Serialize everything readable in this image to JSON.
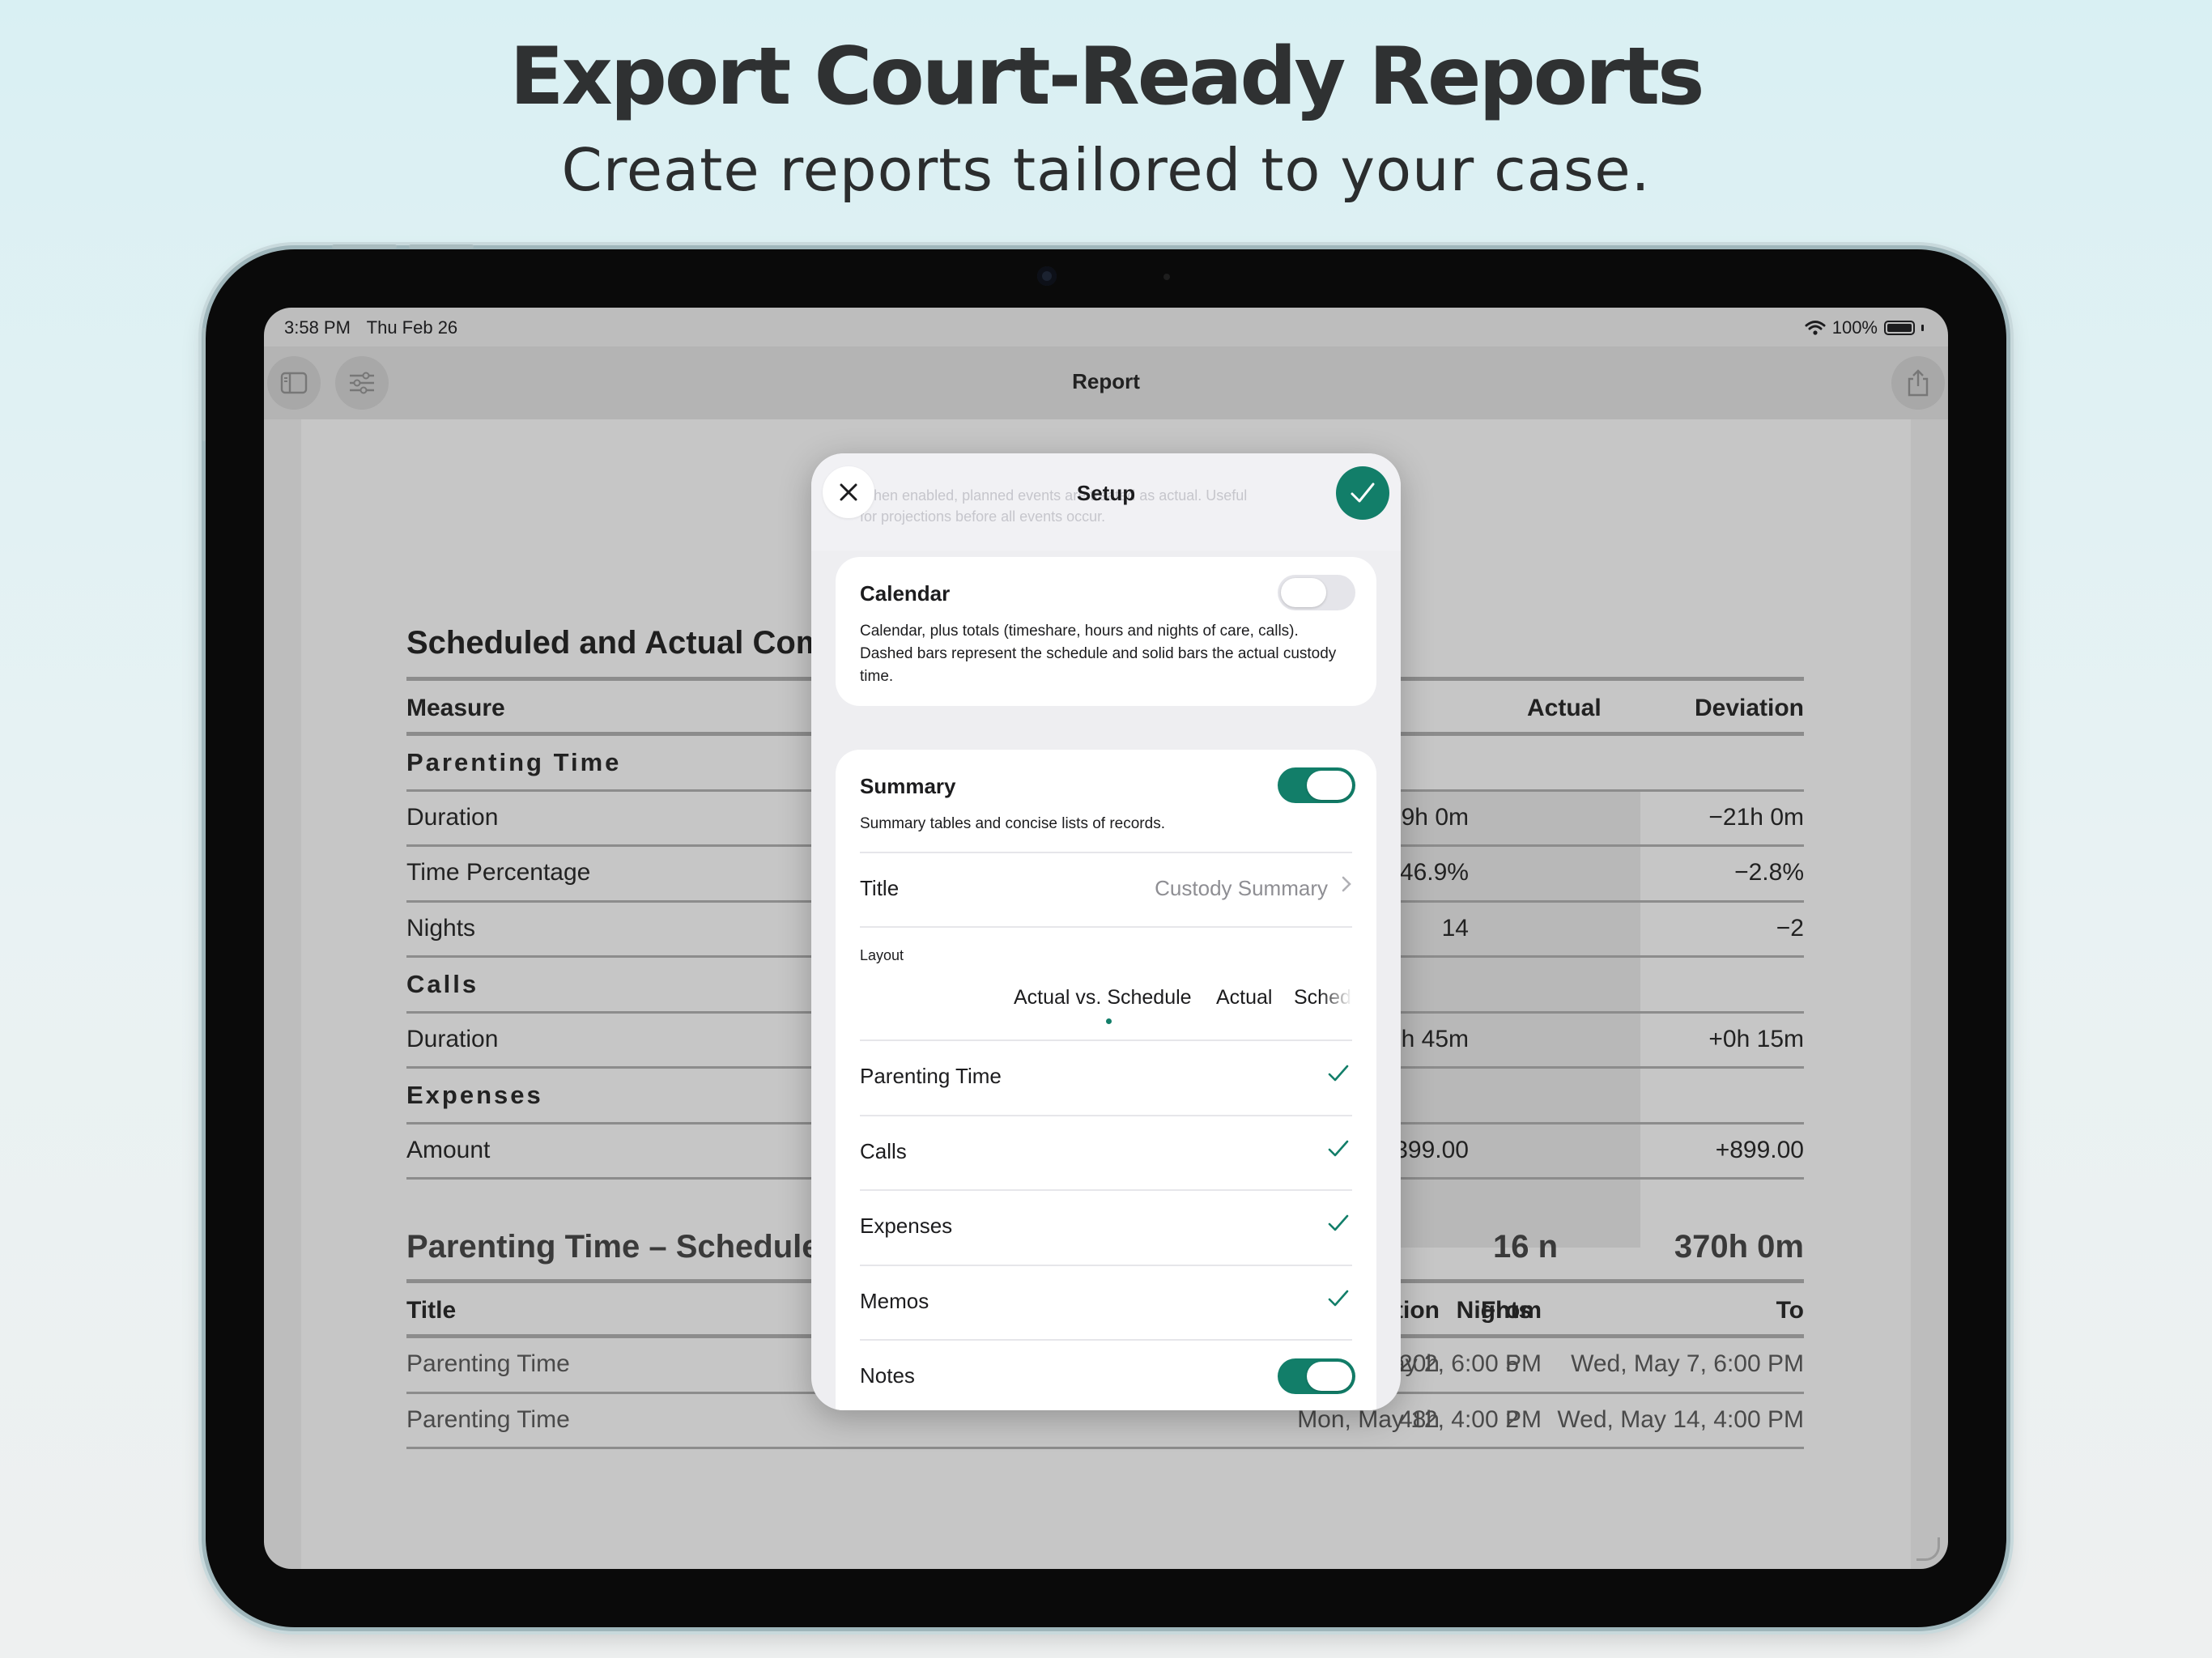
{
  "marketing": {
    "headline": "Export Court-Ready Reports",
    "subhead": "Create reports tailored to your case."
  },
  "status_bar": {
    "time": "3:58 PM",
    "date": "Thu Feb 26",
    "battery": "100%"
  },
  "nav": {
    "title": "Report"
  },
  "document": {
    "section1_title": "Scheduled and Actual Comp",
    "headers": {
      "measure": "Measure",
      "actual": "Actual",
      "deviation": "Deviation"
    },
    "rows": [
      {
        "label": "Parenting Time",
        "category": true,
        "actual": "",
        "deviation": ""
      },
      {
        "label": "Duration",
        "category": false,
        "actual": "9h 0m",
        "deviation": "−21h 0m"
      },
      {
        "label": "Time Percentage",
        "category": false,
        "actual": "46.9%",
        "deviation": "−2.8%"
      },
      {
        "label": "Nights",
        "category": false,
        "actual": "14",
        "deviation": "−2"
      },
      {
        "label": "Calls",
        "category": true,
        "actual": "",
        "deviation": ""
      },
      {
        "label": "Duration",
        "category": false,
        "actual": "h 45m",
        "deviation": "+0h 15m"
      },
      {
        "label": "Expenses",
        "category": true,
        "actual": "",
        "deviation": ""
      },
      {
        "label": "Amount",
        "category": false,
        "actual": "399.00",
        "deviation": "+899.00"
      }
    ],
    "section2_title": "Parenting Time – Scheduled",
    "section2_nights": "16 n",
    "section2_total": "370h 0m",
    "table2_headers": {
      "title": "Title",
      "duration": "Duration",
      "nights": "Nights",
      "from": "From",
      "to": "To"
    },
    "table2_rows": [
      {
        "title": "Parenting Time",
        "duration": "120h",
        "nights": "5",
        "from": "Fri, May 2, 6:00 PM",
        "to": "Wed, May 7, 6:00 PM"
      },
      {
        "title": "Parenting Time",
        "duration": "48h",
        "nights": "2",
        "from": "Mon, May 12, 4:00 PM",
        "to": "Wed, May 14, 4:00 PM"
      }
    ]
  },
  "setup": {
    "title": "Setup",
    "ghost_line1": "When enabled, planned events are treated as actual. Useful",
    "ghost_line2": "for projections before all events occur.",
    "calendar": {
      "label": "Calendar",
      "enabled": false,
      "description": "Calendar, plus totals (timeshare, hours and nights of care, calls). Dashed bars represent the schedule and solid bars the actual custody time."
    },
    "summary": {
      "label": "Summary",
      "enabled": true,
      "description": "Summary tables and concise lists of records.",
      "title_label": "Title",
      "title_value": "Custody Summary",
      "layout_label": "Layout",
      "layout_options": [
        "Actual vs. Schedule",
        "Actual",
        "Sched"
      ],
      "layout_selected": "Actual vs. Schedule",
      "items": [
        {
          "label": "Parenting Time",
          "checked": true
        },
        {
          "label": "Calls",
          "checked": true
        },
        {
          "label": "Expenses",
          "checked": true
        },
        {
          "label": "Memos",
          "checked": true
        }
      ],
      "notes_label": "Notes",
      "notes_enabled": true
    }
  },
  "colors": {
    "accent": "#127e69",
    "background_top": "#d9f0f3",
    "device": "#0a0a0a"
  },
  "icons": [
    "sidebar-icon",
    "sliders-icon",
    "share-icon",
    "close-icon",
    "checkmark-icon",
    "wifi-icon",
    "battery-icon",
    "chevron-right-icon"
  ]
}
